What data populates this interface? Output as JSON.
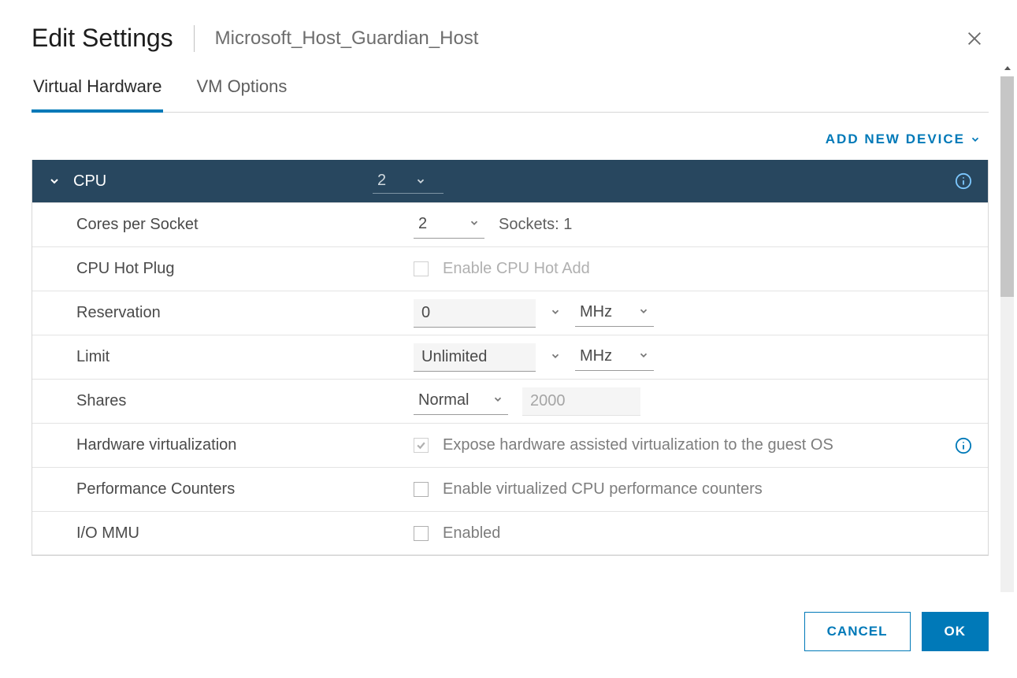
{
  "dialog": {
    "title": "Edit Settings",
    "subtitle": "Microsoft_Host_Guardian_Host"
  },
  "tabs": {
    "virtual_hardware": "Virtual Hardware",
    "vm_options": "VM Options"
  },
  "toolbar": {
    "add_new_device": "ADD NEW DEVICE"
  },
  "cpu": {
    "header_label": "CPU",
    "cpu_count_value": "2",
    "rows": {
      "cores_per_socket": {
        "label": "Cores per Socket",
        "value": "2",
        "sockets_text": "Sockets: 1"
      },
      "cpu_hot_plug": {
        "label": "CPU Hot Plug",
        "cb_label": "Enable CPU Hot Add"
      },
      "reservation": {
        "label": "Reservation",
        "value": "0",
        "unit": "MHz"
      },
      "limit": {
        "label": "Limit",
        "value": "Unlimited",
        "unit": "MHz"
      },
      "shares": {
        "label": "Shares",
        "level": "Normal",
        "value_placeholder": "2000"
      },
      "hw_virt": {
        "label": "Hardware virtualization",
        "cb_label": "Expose hardware assisted virtualization to the guest OS"
      },
      "perf_counters": {
        "label": "Performance Counters",
        "cb_label": "Enable virtualized CPU performance counters"
      },
      "io_mmu": {
        "label": "I/O MMU",
        "cb_label": "Enabled"
      }
    }
  },
  "footer": {
    "cancel": "CANCEL",
    "ok": "OK"
  }
}
